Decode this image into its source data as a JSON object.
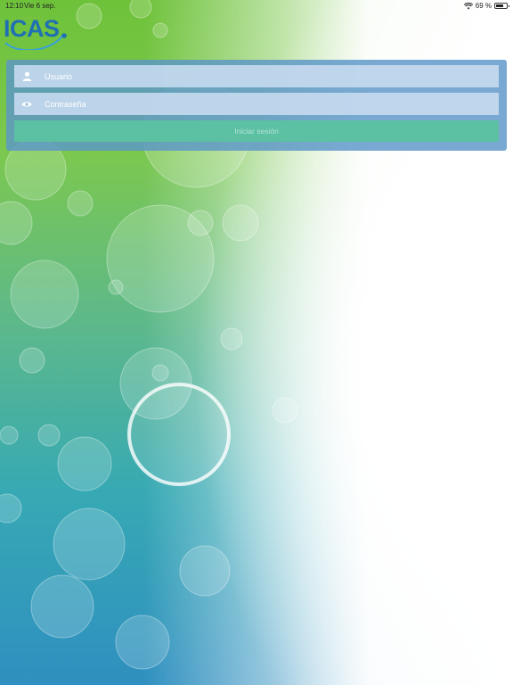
{
  "status_bar": {
    "time": "12:10",
    "date": "Vie 6 sep.",
    "battery_percent_text": "69 %",
    "battery_level": 0.69,
    "wifi_icon": "wifi-icon",
    "battery_icon": "battery-icon"
  },
  "logo": {
    "text": "ICAS"
  },
  "login": {
    "username_placeholder": "Usuario",
    "password_placeholder": "Contraseña",
    "submit_label": "Iniciar sesión",
    "username_icon": "user-icon",
    "password_icon": "eye-icon"
  },
  "colors": {
    "brand_blue": "#1f6fb4",
    "panel": "#5c96c8",
    "button": "#5cc0a2"
  }
}
